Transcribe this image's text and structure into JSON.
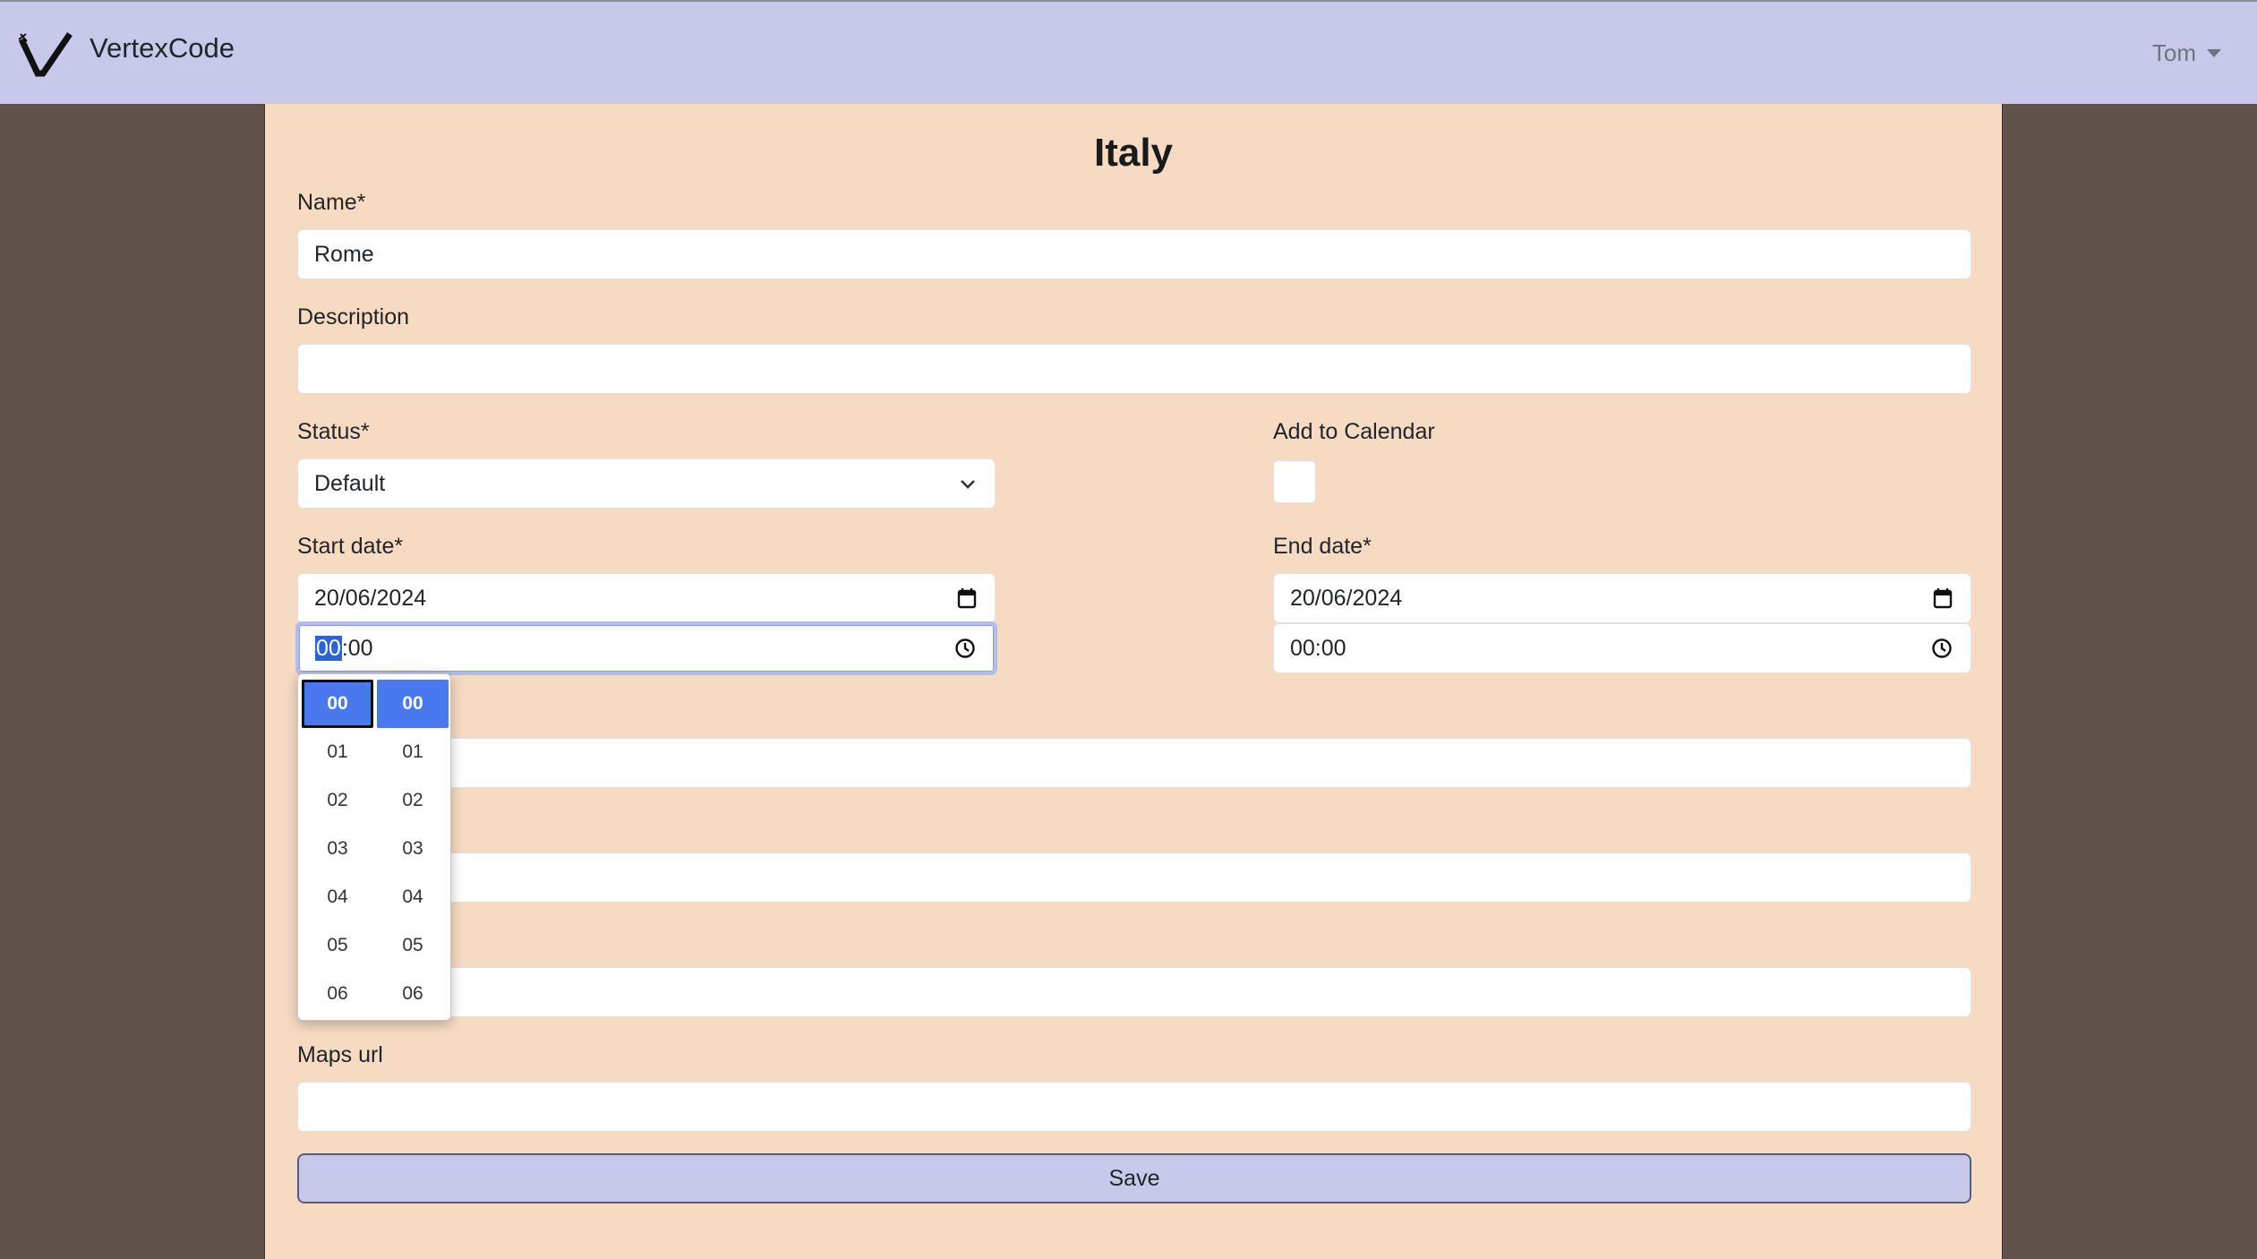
{
  "navbar": {
    "brand": "VertexCode",
    "user": "Tom"
  },
  "page": {
    "title": "Italy"
  },
  "form": {
    "name": {
      "label": "Name*",
      "value": "Rome"
    },
    "description": {
      "label": "Description",
      "value": ""
    },
    "status": {
      "label": "Status*",
      "value": "Default"
    },
    "add_to_calendar": {
      "label": "Add to Calendar",
      "checked": false
    },
    "start_date": {
      "label": "Start date*",
      "date": "20/06/2024",
      "time_hour": "00",
      "time_rest": ":00"
    },
    "end_date": {
      "label": "End date*",
      "date": "20/06/2024",
      "time": "00:00"
    },
    "maps_url": {
      "label": "Maps url",
      "value": ""
    },
    "save_label": "Save"
  },
  "time_picker": {
    "hours": [
      "00",
      "01",
      "02",
      "03",
      "04",
      "05",
      "06"
    ],
    "minutes": [
      "00",
      "01",
      "02",
      "03",
      "04",
      "05",
      "06"
    ]
  }
}
